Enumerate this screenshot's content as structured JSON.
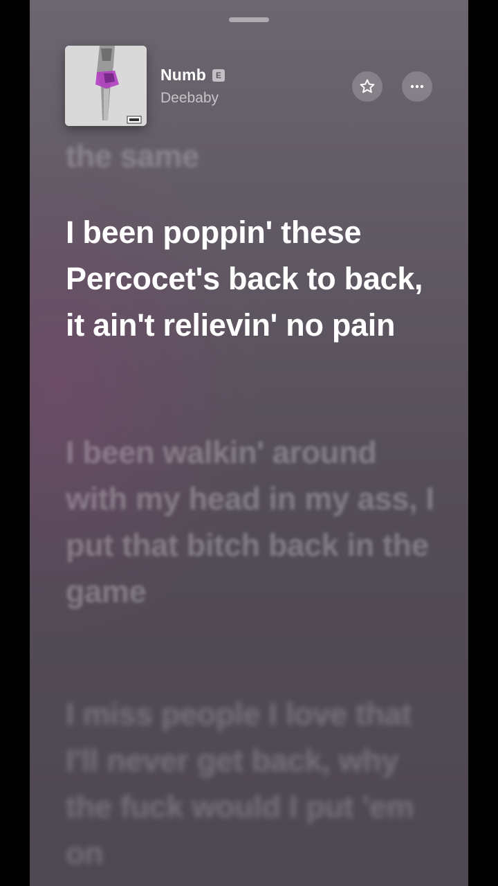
{
  "now_playing": {
    "title": "Numb",
    "explicit_badge": "E",
    "artist": "Deebaby",
    "album_art_icon": "album-cover"
  },
  "actions": {
    "favorite_icon": "star-icon",
    "more_icon": "ellipsis-icon"
  },
  "lyrics": {
    "previous": "the same",
    "current": "I been poppin' these Percocet's back to back, it ain't relievin' no pain",
    "next": "I been walkin' around with my head in my ass, I put that bitch back in the game",
    "later": "I miss people I love that I'll never get back, why the fuck would I put 'em on"
  },
  "colors": {
    "background_top": "#6c6670",
    "background_bottom": "#4e4852",
    "accent_purple": "#b03fc0"
  }
}
